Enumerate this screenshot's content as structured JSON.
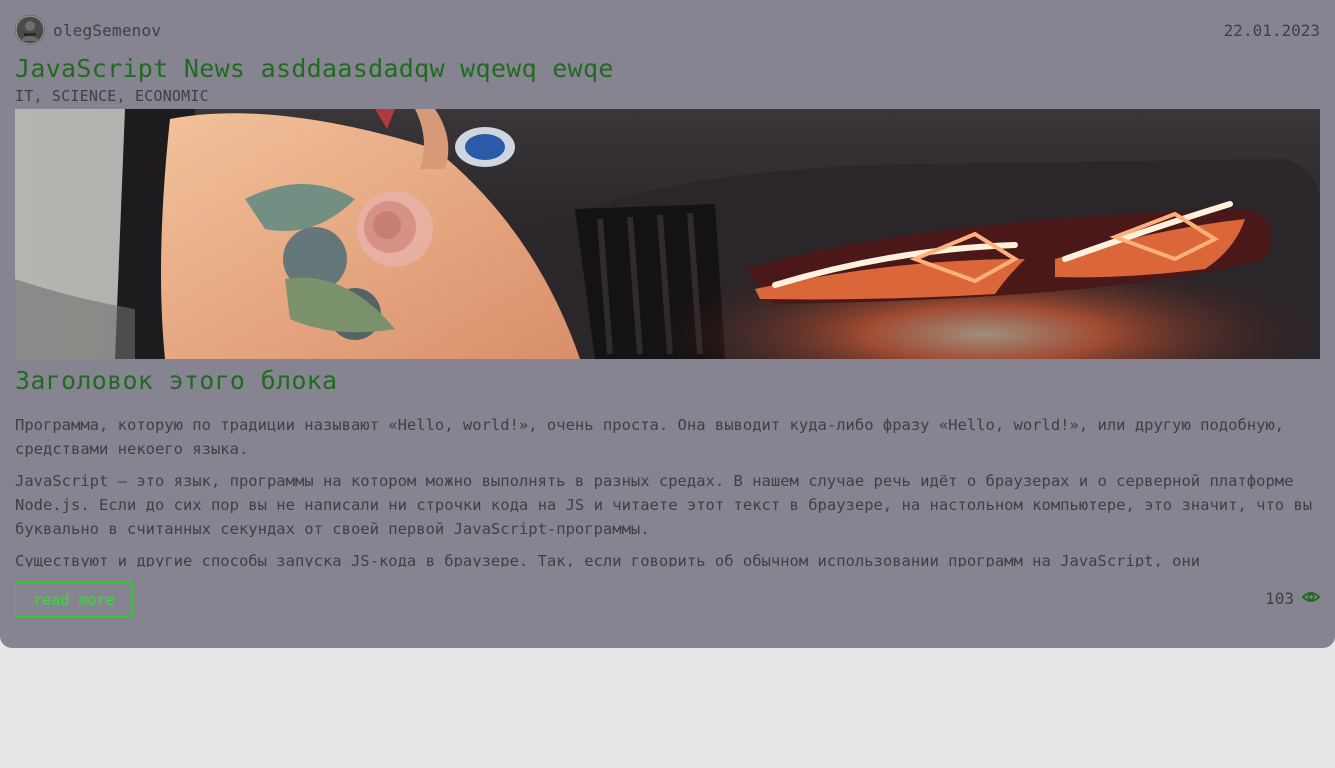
{
  "post": {
    "author": "olegSemenov",
    "date": "22.01.2023",
    "title": "JavaScript News asddaasdadqw wqewq ewqe",
    "tags": "IT, SCIENCE, ECONOMIC",
    "block_title": "Заголовок этого блока",
    "paragraphs": [
      "Программа, которую по традиции называют «Hello, world!», очень проста. Она выводит куда-либо фразу «Hello, world!», или другую подобную, средствами некоего языка.",
      "JavaScript — это язык, программы на котором можно выполнять в разных средах. В нашем случае речь идёт о браузерах и о серверной платформе Node.js. Если до сих пор вы не написали ни строчки кода на JS и читаете этот текст в браузере, на настольном компьютере, это значит, что вы буквально в считанных секундах от своей первой JavaScript-программы.",
      "Существуют и другие способы запуска JS-кода в браузере. Так, если говорить об обычном использовании программ на JavaScript, они"
    ],
    "read_more_label": "read more",
    "views": "103"
  },
  "colors": {
    "card_bg": "#878492",
    "title_green": "#1f6b1f",
    "button_green": "#2fe02f",
    "page_bg": "#e7e7ea"
  },
  "icons": {
    "views": "eye-icon",
    "avatar": "avatar"
  }
}
